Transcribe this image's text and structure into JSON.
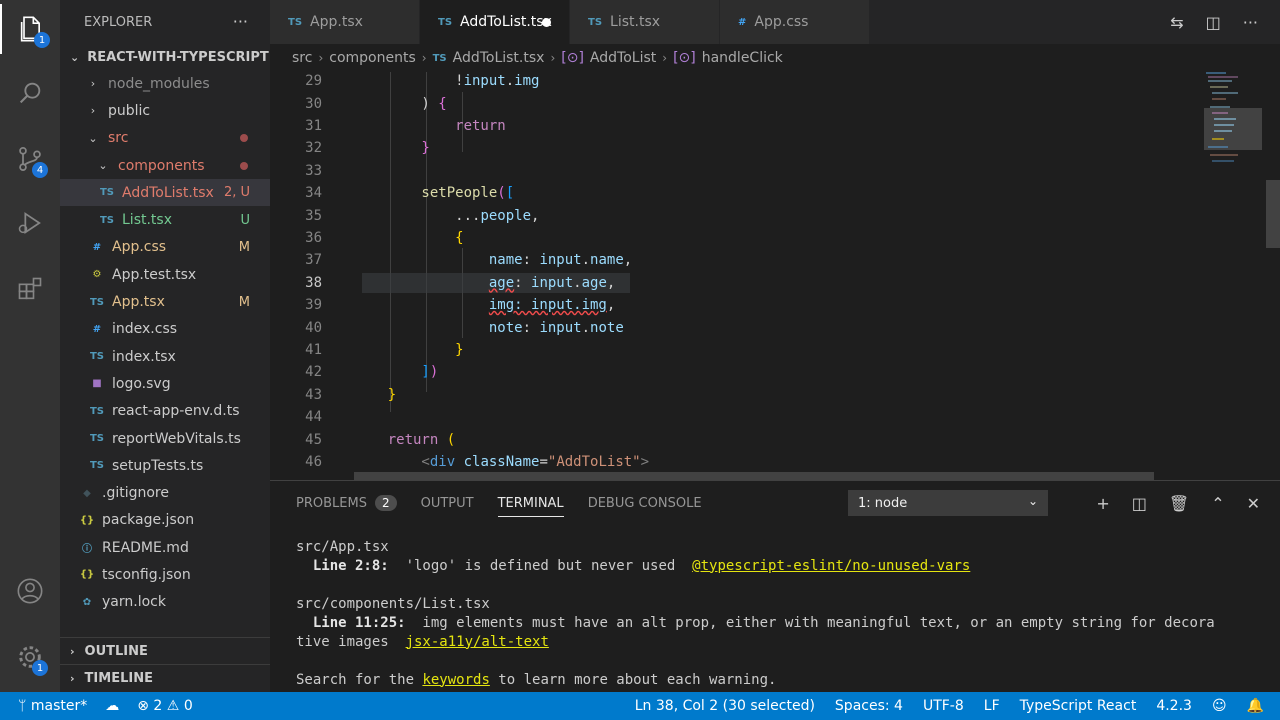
{
  "activity": {
    "explorer_badge": "1",
    "scm_badge": "4",
    "settings_badge": "1"
  },
  "sidebar": {
    "title": "EXPLORER",
    "more": "···",
    "root": "REACT-WITH-TYPESCRIPT",
    "items": [
      {
        "label": "node_modules",
        "icon": "chevron-right",
        "depth": 1
      },
      {
        "label": "public",
        "icon": "chevron-right",
        "depth": 1
      },
      {
        "label": "src",
        "icon": "chevron-down",
        "depth": 1,
        "deco": "dot"
      },
      {
        "label": "components",
        "icon": "chevron-down",
        "depth": 2,
        "deco": "dot"
      },
      {
        "label": "AddToList.tsx",
        "icon": "TS",
        "depth": 3,
        "deco": "2, U"
      },
      {
        "label": "List.tsx",
        "icon": "TS",
        "depth": 3,
        "deco": "U"
      },
      {
        "label": "App.css",
        "icon": "#",
        "depth": 2,
        "deco": "M"
      },
      {
        "label": "App.test.tsx",
        "icon": "test",
        "depth": 2
      },
      {
        "label": "App.tsx",
        "icon": "TS",
        "depth": 2,
        "deco": "M"
      },
      {
        "label": "index.css",
        "icon": "#",
        "depth": 2
      },
      {
        "label": "index.tsx",
        "icon": "TS",
        "depth": 2
      },
      {
        "label": "logo.svg",
        "icon": "svg",
        "depth": 2
      },
      {
        "label": "react-app-env.d.ts",
        "icon": "TS",
        "depth": 2
      },
      {
        "label": "reportWebVitals.ts",
        "icon": "TS",
        "depth": 2
      },
      {
        "label": "setupTests.ts",
        "icon": "TS",
        "depth": 2
      },
      {
        "label": ".gitignore",
        "icon": "git",
        "depth": 1
      },
      {
        "label": "package.json",
        "icon": "{}",
        "depth": 1
      },
      {
        "label": "README.md",
        "icon": "info",
        "depth": 1
      },
      {
        "label": "tsconfig.json",
        "icon": "{}",
        "depth": 1
      },
      {
        "label": "yarn.lock",
        "icon": "yarn",
        "depth": 1
      }
    ],
    "outline": "OUTLINE",
    "timeline": "TIMELINE"
  },
  "tabs": [
    {
      "label": "App.tsx",
      "icon": "TS"
    },
    {
      "label": "AddToList.tsx",
      "icon": "TS",
      "active": true
    },
    {
      "label": "List.tsx",
      "icon": "TS"
    },
    {
      "label": "App.css",
      "icon": "#"
    }
  ],
  "breadcrumb": [
    "src",
    "components",
    "AddToList.tsx",
    "AddToList",
    "handleClick"
  ],
  "editor": {
    "lines": [
      {
        "n": "29",
        "code": "            !input.img"
      },
      {
        "n": "30",
        "code": "        ) {"
      },
      {
        "n": "31",
        "code": "            return"
      },
      {
        "n": "32",
        "code": "        }"
      },
      {
        "n": "33",
        "code": ""
      },
      {
        "n": "34",
        "code": "        setPeople(["
      },
      {
        "n": "35",
        "code": "            ...people,"
      },
      {
        "n": "36",
        "code": "            {"
      },
      {
        "n": "37",
        "code": "                name: input.name,"
      },
      {
        "n": "38",
        "code": "                age: input.age,"
      },
      {
        "n": "39",
        "code": "                img: input.img,"
      },
      {
        "n": "40",
        "code": "                note: input.note"
      },
      {
        "n": "41",
        "code": "            }"
      },
      {
        "n": "42",
        "code": "        ])"
      },
      {
        "n": "43",
        "code": "    }"
      },
      {
        "n": "44",
        "code": ""
      },
      {
        "n": "45",
        "code": "    return ("
      },
      {
        "n": "46",
        "code": "        <div className=\"AddToList\">"
      }
    ]
  },
  "panel": {
    "tabs": [
      {
        "label": "PROBLEMS",
        "badge": "2"
      },
      {
        "label": "OUTPUT"
      },
      {
        "label": "TERMINAL",
        "active": true
      },
      {
        "label": "DEBUG CONSOLE"
      }
    ],
    "terminal_select": "1: node",
    "terminal": {
      "file1": "src/App.tsx",
      "line1_pos": "  Line 2:8:",
      "line1_msg": "  'logo' is defined but never used  ",
      "line1_rule": "@typescript-eslint/no-unused-vars",
      "file2": "src/components/List.tsx",
      "line2_pos": "  Line 11:25:",
      "line2_msg": "  img elements must have an alt prop, either with meaningful text, or an empty string for decora",
      "line2_cont": "tive images  ",
      "line2_rule": "jsx-a11y/alt-text",
      "search_a": "Search for the ",
      "search_kw": "keywords",
      "search_b": " to learn more about each warning."
    }
  },
  "status": {
    "branch": "master*",
    "errors": "2",
    "warnings": "0",
    "position": "Ln 38, Col 2 (30 selected)",
    "spaces": "Spaces: 4",
    "encoding": "UTF-8",
    "eol": "LF",
    "language": "TypeScript React",
    "version": "4.2.3"
  }
}
